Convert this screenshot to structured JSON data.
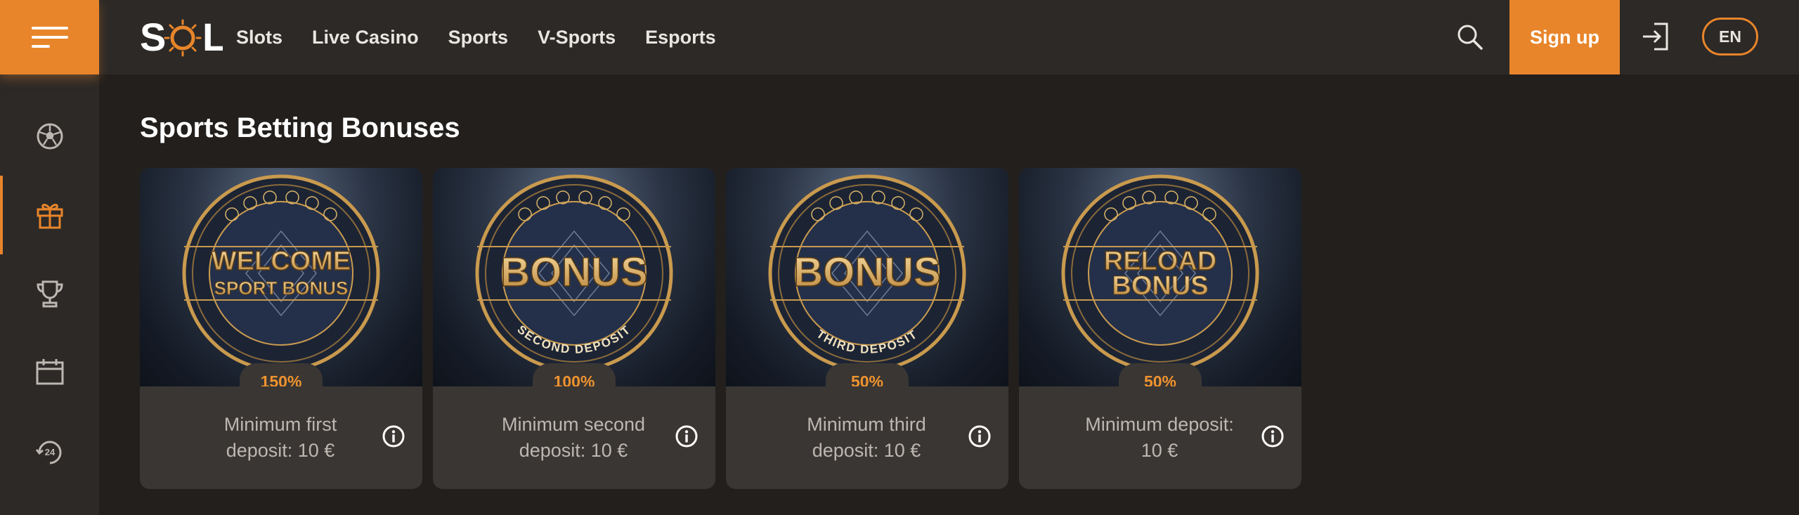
{
  "header": {
    "logo_text": "SOL",
    "nav": [
      "Slots",
      "Live Casino",
      "Sports",
      "V-Sports",
      "Esports"
    ],
    "signup_label": "Sign up",
    "language": "EN"
  },
  "sidebar": {
    "items": [
      {
        "icon": "soccer-ball-icon",
        "active": false
      },
      {
        "icon": "gift-icon",
        "active": true
      },
      {
        "icon": "trophy-icon",
        "active": false
      },
      {
        "icon": "calendar-icon",
        "active": false
      },
      {
        "icon": "support-24-icon",
        "active": false
      }
    ]
  },
  "main": {
    "title": "Sports Betting Bonuses",
    "cards": [
      {
        "line1": "WELCOME",
        "line2": "SPORT BONUS",
        "ring_text": "",
        "percent": "150%",
        "desc": "Minimum first deposit: 10 €"
      },
      {
        "line1": "BONUS",
        "line2": "",
        "ring_text": "SECOND DEPOSIT",
        "percent": "100%",
        "desc": "Minimum second deposit: 10 €"
      },
      {
        "line1": "BONUS",
        "line2": "",
        "ring_text": "THIRD DEPOSIT",
        "percent": "50%",
        "desc": "Minimum third deposit: 10 €"
      },
      {
        "line1": "RELOAD",
        "line2": "BONUS",
        "ring_text": "",
        "percent": "50%",
        "desc": "Minimum deposit: 10 €"
      }
    ]
  },
  "colors": {
    "accent": "#e8852a",
    "background": "#221f1d",
    "panel": "#2c2927",
    "card": "#3a3633",
    "gold": "#d9a54a"
  }
}
